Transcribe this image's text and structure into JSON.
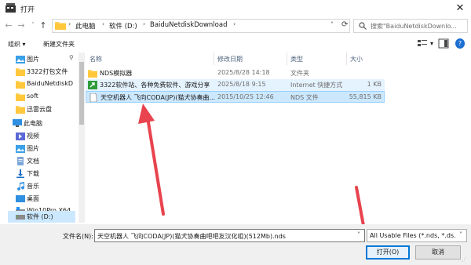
{
  "window": {
    "title": "打开",
    "close_glyph": "✕"
  },
  "nav": {
    "back": "←",
    "forward": "→",
    "recent": "˅",
    "up": "↑",
    "breadcrumb": [
      "此电脑",
      "软件 (D:)",
      "BaiduNetdiskDownload"
    ],
    "sep": "›",
    "search_placeholder": "搜索\"BaiduNetdiskDownlo..."
  },
  "toolbar": {
    "organize": "组织 ▾",
    "new_folder": "新建文件夹"
  },
  "sidebar": {
    "items": [
      {
        "label": "图片",
        "icon": "pictures-icon",
        "pinned": true
      },
      {
        "label": "3322打包文件",
        "icon": "folder-icon"
      },
      {
        "label": "BaiduNetdiskD",
        "icon": "folder-icon"
      },
      {
        "label": "soft",
        "icon": "folder-icon"
      },
      {
        "label": "迅雷云盘",
        "icon": "folder-icon"
      },
      {
        "label": "此电脑",
        "icon": "computer-icon"
      },
      {
        "label": "视频",
        "icon": "videos-icon"
      },
      {
        "label": "图片",
        "icon": "pictures-icon"
      },
      {
        "label": "文档",
        "icon": "documents-icon"
      },
      {
        "label": "下载",
        "icon": "downloads-icon"
      },
      {
        "label": "音乐",
        "icon": "music-icon"
      },
      {
        "label": "桌面",
        "icon": "desktop-icon"
      },
      {
        "label": "Win10Pro X64",
        "icon": "drive-icon"
      },
      {
        "label": "软件 (D:)",
        "icon": "drive-icon",
        "selected": true
      }
    ]
  },
  "columns": {
    "name": "名称",
    "date": "修改日期",
    "type": "类型",
    "size": "大小"
  },
  "files": [
    {
      "name": "NDS模拟器",
      "date": "2025/8/28 14:18",
      "type": "文件夹",
      "size": "",
      "icon": "folder-icon"
    },
    {
      "name": "3322软件站、各种免费软件、游戏分享",
      "date": "2025/8/18 9:15",
      "type": "Internet 快捷方式",
      "size": "1 KB",
      "icon": "shortcut-icon"
    },
    {
      "name": "天空机器人 飞向CODA(JP)(猫犬协奏曲...",
      "date": "2015/10/25 12:46",
      "type": "NDS 文件",
      "size": "55,815 KB",
      "icon": "file-icon",
      "selected": true
    }
  ],
  "bottom": {
    "filename_label": "文件名(N):",
    "filename_value": "天空机器人 飞向CODA(JP)(猫犬协奏曲吧吧友汉化组)(512Mb).nds",
    "filetype_value": "All Usable Files (*.nds, *.ds.g",
    "open_button": "打开(O)",
    "cancel_button": "取消"
  },
  "colors": {
    "selection": "#cce8ff",
    "accent": "#0078d7",
    "annotation_arrow": "#e8434e"
  }
}
